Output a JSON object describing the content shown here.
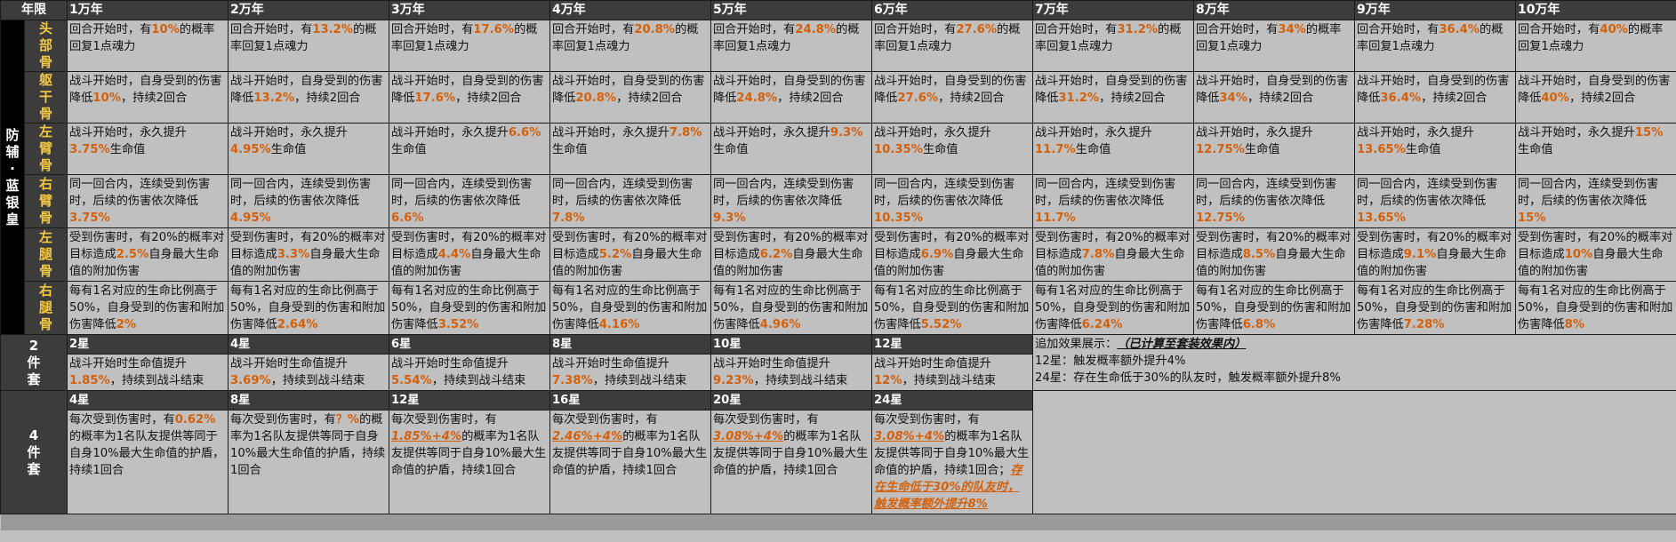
{
  "header": {
    "year_label": "年限",
    "years": [
      "1万年",
      "2万年",
      "3万年",
      "4万年",
      "5万年",
      "6万年",
      "7万年",
      "8万年",
      "9万年",
      "10万年"
    ]
  },
  "side_label": "防辅·蓝银皇",
  "parts": [
    {
      "name": "头部骨",
      "cells": [
        {
          "pre": "回合开始时，有",
          "val": "10%",
          "post": "的概率回复1点魂力"
        },
        {
          "pre": "回合开始时，有",
          "val": "13.2%",
          "post": "的概率回复1点魂力"
        },
        {
          "pre": "回合开始时，有",
          "val": "17.6%",
          "post": "的概率回复1点魂力"
        },
        {
          "pre": "回合开始时，有",
          "val": "20.8%",
          "post": "的概率回复1点魂力"
        },
        {
          "pre": "回合开始时，有",
          "val": "24.8%",
          "post": "的概率回复1点魂力"
        },
        {
          "pre": "回合开始时，有",
          "val": "27.6%",
          "post": "的概率回复1点魂力"
        },
        {
          "pre": "回合开始时，有",
          "val": "31.2%",
          "post": "的概率回复1点魂力"
        },
        {
          "pre": "回合开始时，有",
          "val": "34%",
          "post": "的概率回复1点魂力"
        },
        {
          "pre": "回合开始时，有",
          "val": "36.4%",
          "post": "的概率回复1点魂力"
        },
        {
          "pre": "回合开始时，有",
          "val": "40%",
          "post": "的概率回复1点魂力"
        }
      ]
    },
    {
      "name": "躯干骨",
      "cells": [
        {
          "pre": "战斗开始时，自身受到的伤害降低",
          "val": "10%",
          "post": "，持续2回合"
        },
        {
          "pre": "战斗开始时，自身受到的伤害降低",
          "val": "13.2%",
          "post": "，持续2回合"
        },
        {
          "pre": "战斗开始时，自身受到的伤害降低",
          "val": "17.6%",
          "post": "，持续2回合"
        },
        {
          "pre": "战斗开始时，自身受到的伤害降低",
          "val": "20.8%",
          "post": "，持续2回合"
        },
        {
          "pre": "战斗开始时，自身受到的伤害降低",
          "val": "24.8%",
          "post": "，持续2回合"
        },
        {
          "pre": "战斗开始时，自身受到的伤害降低",
          "val": "27.6%",
          "post": "，持续2回合"
        },
        {
          "pre": "战斗开始时，自身受到的伤害降低",
          "val": "31.2%",
          "post": "，持续2回合"
        },
        {
          "pre": "战斗开始时，自身受到的伤害降低",
          "val": "34%",
          "post": "，持续2回合"
        },
        {
          "pre": "战斗开始时，自身受到的伤害降低",
          "val": "36.4%",
          "post": "，持续2回合"
        },
        {
          "pre": "战斗开始时，自身受到的伤害降低",
          "val": "40%",
          "post": "，持续2回合"
        }
      ]
    },
    {
      "name": "左臂骨",
      "cells": [
        {
          "pre": "战斗开始时，永久提升",
          "val": "3.75%",
          "post": "生命值"
        },
        {
          "pre": "战斗开始时，永久提升",
          "val": "4.95%",
          "post": "生命值"
        },
        {
          "pre": "战斗开始时，永久提升",
          "val": "6.6%",
          "post": "生命值"
        },
        {
          "pre": "战斗开始时，永久提升",
          "val": "7.8%",
          "post": "生命值"
        },
        {
          "pre": "战斗开始时，永久提升",
          "val": "9.3%",
          "post": "生命值"
        },
        {
          "pre": "战斗开始时，永久提升",
          "val": "10.35%",
          "post": "生命值"
        },
        {
          "pre": "战斗开始时，永久提升",
          "val": "11.7%",
          "post": "生命值"
        },
        {
          "pre": "战斗开始时，永久提升",
          "val": "12.75%",
          "post": "生命值"
        },
        {
          "pre": "战斗开始时，永久提升",
          "val": "13.65%",
          "post": "生命值"
        },
        {
          "pre": "战斗开始时，永久提升",
          "val": "15%",
          "post": "生命值"
        }
      ]
    },
    {
      "name": "右臂骨",
      "cells": [
        {
          "pre": "同一回合内，连续受到伤害时，后续的伤害依次降低",
          "val": "3.75%",
          "post": ""
        },
        {
          "pre": "同一回合内，连续受到伤害时，后续的伤害依次降低",
          "val": "4.95%",
          "post": ""
        },
        {
          "pre": "同一回合内，连续受到伤害时，后续的伤害依次降低",
          "val": "6.6%",
          "post": ""
        },
        {
          "pre": "同一回合内，连续受到伤害时，后续的伤害依次降低",
          "val": "7.8%",
          "post": ""
        },
        {
          "pre": "同一回合内，连续受到伤害时，后续的伤害依次降低",
          "val": "9.3%",
          "post": ""
        },
        {
          "pre": "同一回合内，连续受到伤害时，后续的伤害依次降低",
          "val": "10.35%",
          "post": ""
        },
        {
          "pre": "同一回合内，连续受到伤害时，后续的伤害依次降低",
          "val": "11.7%",
          "post": ""
        },
        {
          "pre": "同一回合内，连续受到伤害时，后续的伤害依次降低",
          "val": "12.75%",
          "post": ""
        },
        {
          "pre": "同一回合内，连续受到伤害时，后续的伤害依次降低",
          "val": "13.65%",
          "post": ""
        },
        {
          "pre": "同一回合内，连续受到伤害时，后续的伤害依次降低",
          "val": "15%",
          "post": ""
        }
      ]
    },
    {
      "name": "左腿骨",
      "cells": [
        {
          "pre": "受到伤害时，有20%的概率对目标造成",
          "val": "2.5%",
          "post": "自身最大生命值的附加伤害"
        },
        {
          "pre": "受到伤害时，有20%的概率对目标造成",
          "val": "3.3%",
          "post": "自身最大生命值的附加伤害"
        },
        {
          "pre": "受到伤害时，有20%的概率对目标造成",
          "val": "4.4%",
          "post": "自身最大生命值的附加伤害"
        },
        {
          "pre": "受到伤害时，有20%的概率对目标造成",
          "val": "5.2%",
          "post": "自身最大生命值的附加伤害"
        },
        {
          "pre": "受到伤害时，有20%的概率对目标造成",
          "val": "6.2%",
          "post": "自身最大生命值的附加伤害"
        },
        {
          "pre": "受到伤害时，有20%的概率对目标造成",
          "val": "6.9%",
          "post": "自身最大生命值的附加伤害"
        },
        {
          "pre": "受到伤害时，有20%的概率对目标造成",
          "val": "7.8%",
          "post": "自身最大生命值的附加伤害"
        },
        {
          "pre": "受到伤害时，有20%的概率对目标造成",
          "val": "8.5%",
          "post": "自身最大生命值的附加伤害"
        },
        {
          "pre": "受到伤害时，有20%的概率对目标造成",
          "val": "9.1%",
          "post": "自身最大生命值的附加伤害"
        },
        {
          "pre": "受到伤害时，有20%的概率对目标造成",
          "val": "10%",
          "post": "自身最大生命值的附加伤害"
        }
      ]
    },
    {
      "name": "右腿骨",
      "cells": [
        {
          "pre": "每有1名对应的生命比例高于50%，自身受到的伤害和附加伤害降低",
          "val": "2%",
          "post": ""
        },
        {
          "pre": "每有1名对应的生命比例高于50%，自身受到的伤害和附加伤害降低",
          "val": "2.64%",
          "post": ""
        },
        {
          "pre": "每有1名对应的生命比例高于50%，自身受到的伤害和附加伤害降低",
          "val": "3.52%",
          "post": ""
        },
        {
          "pre": "每有1名对应的生命比例高于50%，自身受到的伤害和附加伤害降低",
          "val": "4.16%",
          "post": ""
        },
        {
          "pre": "每有1名对应的生命比例高于50%，自身受到的伤害和附加伤害降低",
          "val": "4.96%",
          "post": ""
        },
        {
          "pre": "每有1名对应的生命比例高于50%，自身受到的伤害和附加伤害降低",
          "val": "5.52%",
          "post": ""
        },
        {
          "pre": "每有1名对应的生命比例高于50%，自身受到的伤害和附加伤害降低",
          "val": "6.24%",
          "post": ""
        },
        {
          "pre": "每有1名对应的生命比例高于50%，自身受到的伤害和附加伤害降低",
          "val": "6.8%",
          "post": ""
        },
        {
          "pre": "每有1名对应的生命比例高于50%，自身受到的伤害和附加伤害降低",
          "val": "7.28%",
          "post": ""
        },
        {
          "pre": "每有1名对应的生命比例高于50%，自身受到的伤害和附加伤害降低",
          "val": "8%",
          "post": ""
        }
      ]
    }
  ],
  "set2": {
    "name": "2件套",
    "levels": [
      "2星",
      "4星",
      "6星",
      "8星",
      "10星",
      "12星"
    ],
    "cells": [
      {
        "pre": "战斗开始时生命值提升",
        "val": "1.85%",
        "post": "，持续到战斗结束"
      },
      {
        "pre": "战斗开始时生命值提升",
        "val": "3.69%",
        "post": "，持续到战斗结束"
      },
      {
        "pre": "战斗开始时生命值提升",
        "val": "5.54%",
        "post": "，持续到战斗结束"
      },
      {
        "pre": "战斗开始时生命值提升",
        "val": "7.38%",
        "post": "，持续到战斗结束"
      },
      {
        "pre": "战斗开始时生命值提升",
        "val": "9.23%",
        "post": "，持续到战斗结束"
      },
      {
        "pre": "战斗开始时生命值提升",
        "val": "12%",
        "post": "，持续到战斗结束"
      }
    ],
    "note_title": "追加效果展示：",
    "note_title_em": "（已计算至套装效果内）",
    "note_lines": [
      "12星：触发概率额外提升4%",
      "24星：存在生命低于30%的队友时，触发概率额外提升8%"
    ]
  },
  "set4": {
    "name": "4件套",
    "levels": [
      "4星",
      "8星",
      "12星",
      "16星",
      "20星",
      "24星"
    ],
    "cells": [
      {
        "pre": "每次受到伤害时，有",
        "val": "0.62%",
        "val_style": "hl",
        "post": "的概率为1名队友提供等同于自身10%最大生命值的护盾，持续1回合",
        "extra": ""
      },
      {
        "pre": "每次受到伤害时，有",
        "val": "？%",
        "val_style": "hl",
        "post": "的概率为1名队友提供等同于自身10%最大生命值的护盾，持续1回合",
        "extra": ""
      },
      {
        "pre": "每次受到伤害时，有",
        "val": "1.85%+4%",
        "val_style": "hlu",
        "post": "的概率为1名队友提供等同于自身10%最大生命值的护盾，持续1回合",
        "extra": ""
      },
      {
        "pre": "每次受到伤害时，有",
        "val": "2.46%+4%",
        "val_style": "hlu",
        "post": "的概率为1名队友提供等同于自身10%最大生命值的护盾，持续1回合",
        "extra": ""
      },
      {
        "pre": "每次受到伤害时，有",
        "val": "3.08%+4%",
        "val_style": "hlu",
        "post": "的概率为1名队友提供等同于自身10%最大生命值的护盾，持续1回合",
        "extra": ""
      },
      {
        "pre": "每次受到伤害时，有",
        "val": "3.08%+4%",
        "val_style": "hlu",
        "post": "的概率为1名队友提供等同于自身10%最大生命值的护盾，持续1回合；",
        "extra": "存在生命低于30%的队友时，触发概率额外提升8%"
      }
    ]
  }
}
